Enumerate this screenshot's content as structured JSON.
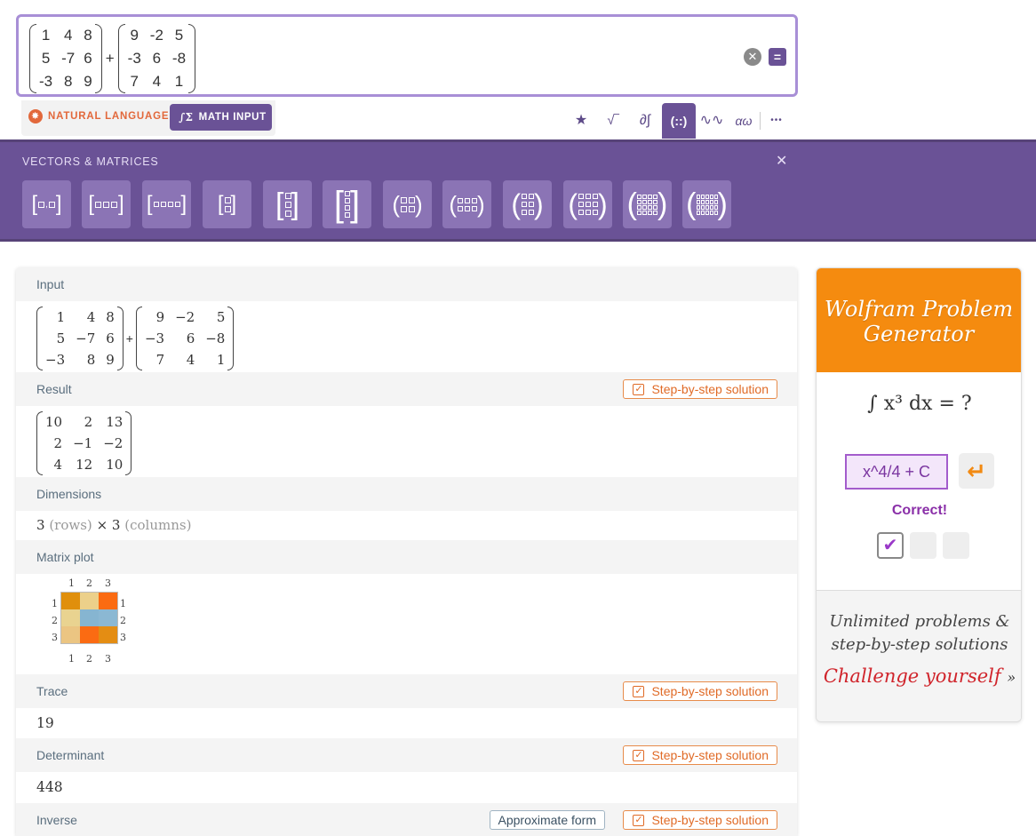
{
  "input": {
    "matrix_a": [
      "1",
      "4",
      "8",
      "5",
      "-7",
      "6",
      "-3",
      "8",
      "9"
    ],
    "operator": "+",
    "matrix_b": [
      "9",
      "-2",
      "5",
      "-3",
      "6",
      "-8",
      "7",
      "4",
      "1"
    ]
  },
  "mode": {
    "natural_language": "NATURAL LANGUAGE",
    "math_input": "MATH INPUT"
  },
  "toolbar": {
    "icons": [
      "star-icon",
      "sqrt-icon",
      "calculus-icon",
      "matrix-icon",
      "waveform-icon",
      "greek-icon",
      "more-icon"
    ],
    "glyphs": [
      "★",
      "√‾",
      "∂∫",
      "(::)",
      "∿∿",
      "αω",
      "•••"
    ]
  },
  "vectors_panel": {
    "title": "VECTORS & MATRICES"
  },
  "pods": {
    "input_label": "Input",
    "input_a": [
      "1",
      "4",
      "8",
      "5",
      "−7",
      "6",
      "−3",
      "8",
      "9"
    ],
    "input_b": [
      "9",
      "−2",
      "5",
      "−3",
      "6",
      "−8",
      "7",
      "4",
      "1"
    ],
    "result_label": "Result",
    "result": [
      "10",
      "2",
      "13",
      "2",
      "−1",
      "−2",
      "4",
      "12",
      "10"
    ],
    "dimensions_label": "Dimensions",
    "dimensions": {
      "rows_value": "3",
      "rows_label": "(rows)",
      "times": "×",
      "cols_value": "3",
      "cols_label": "(columns)"
    },
    "matrix_plot_label": "Matrix plot",
    "matrix_plot": {
      "ticks": [
        "1",
        "2",
        "3"
      ],
      "colors": [
        "#e08f0c",
        "#ecd08a",
        "#fb6b12",
        "#e9d390",
        "#86b5d1",
        "#8bb8d3",
        "#ebc582",
        "#fb6b12",
        "#e48d13"
      ]
    },
    "trace_label": "Trace",
    "trace": "19",
    "determinant_label": "Determinant",
    "determinant": "448",
    "inverse_label": "Inverse",
    "approximate_form": "Approximate form",
    "step_by_step": "Step-by-step solution"
  },
  "generator": {
    "title_line1": "Wolfram Problem",
    "title_line2": "Generator",
    "question": "∫ x³ dx = ?",
    "answer": "x^4/4 + C",
    "enter_glyph": "↵",
    "status": "Correct!",
    "check_glyph": "✔",
    "footer_line1": "Unlimited problems &",
    "footer_line2": "step-by-step solutions",
    "cta": "Challenge yourself",
    "cta_arrow": "»"
  }
}
